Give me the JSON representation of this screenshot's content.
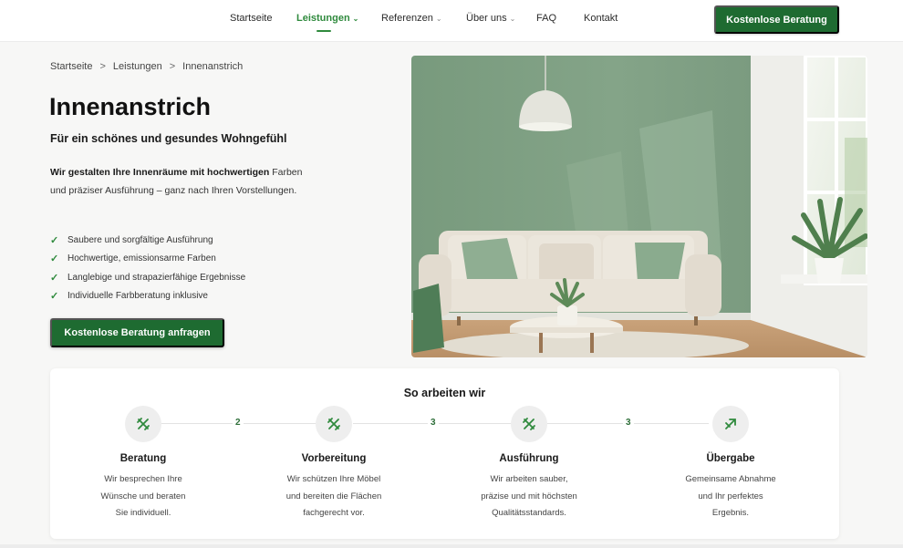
{
  "nav": {
    "items": [
      {
        "label": "Startseite",
        "active": false,
        "dropdown": false
      },
      {
        "label": "Leistungen",
        "active": true,
        "dropdown": true
      },
      {
        "label": "Referenzen",
        "active": false,
        "dropdown": true
      },
      {
        "label": "Über uns",
        "active": false,
        "dropdown": true
      },
      {
        "label": "FAQ",
        "active": false,
        "dropdown": false
      },
      {
        "label": "Kontakt",
        "active": false,
        "dropdown": false
      }
    ],
    "chevron": "⌄",
    "cta_label": "Kostenlose Beratung"
  },
  "breadcrumb": {
    "items": [
      "Startseite",
      "Leistungen",
      "Innenanstrich"
    ],
    "separator": ">"
  },
  "hero": {
    "title": "Innenanstrich",
    "subtitle": "Für ein schönes und gesundes Wohngefühl",
    "intro_bold": "Wir gestalten Ihre Innenräume mit hochwertigen",
    "intro_rest": "Farben und präziser Ausführung – ganz nach Ihren Vorstellungen.",
    "features": [
      "Saubere und sorgfältige Ausführung",
      "Hochwertige, emissionsarme Farben",
      "Langlebige und strapazierfähige Ergebnisse",
      "Individuelle Farbberatung inklusive"
    ],
    "cta_label": "Kostenlose Beratung anfragen",
    "image_description_icon": "living-room-photo"
  },
  "process": {
    "title": "So arbeiten wir",
    "connector_numbers": [
      "2",
      "3",
      "3"
    ],
    "steps": [
      {
        "title": "Beratung",
        "text_lines": [
          "Wir besprechen Ihre",
          "Wünsche und beraten",
          "Sie individuell."
        ]
      },
      {
        "title": "Vorbereitung",
        "text_lines": [
          "Wir schützen Ihre Möbel",
          "und bereiten die Flächen",
          "fachgerecht vor."
        ]
      },
      {
        "title": "Ausführung",
        "text_lines": [
          "Wir arbeiten sauber,",
          "präzise und mit höchsten",
          "Qualitätsstandards."
        ]
      },
      {
        "title": "Übergabe",
        "text_lines": [
          "Gemeinsame Abnahme",
          "und Ihr perfektes",
          "Ergebnis."
        ]
      }
    ]
  },
  "colors": {
    "brand_green": "#1e6b31",
    "accent_green": "#2f8a3d",
    "wall_green": "#7f9f83",
    "background": "#f7f7f6"
  }
}
